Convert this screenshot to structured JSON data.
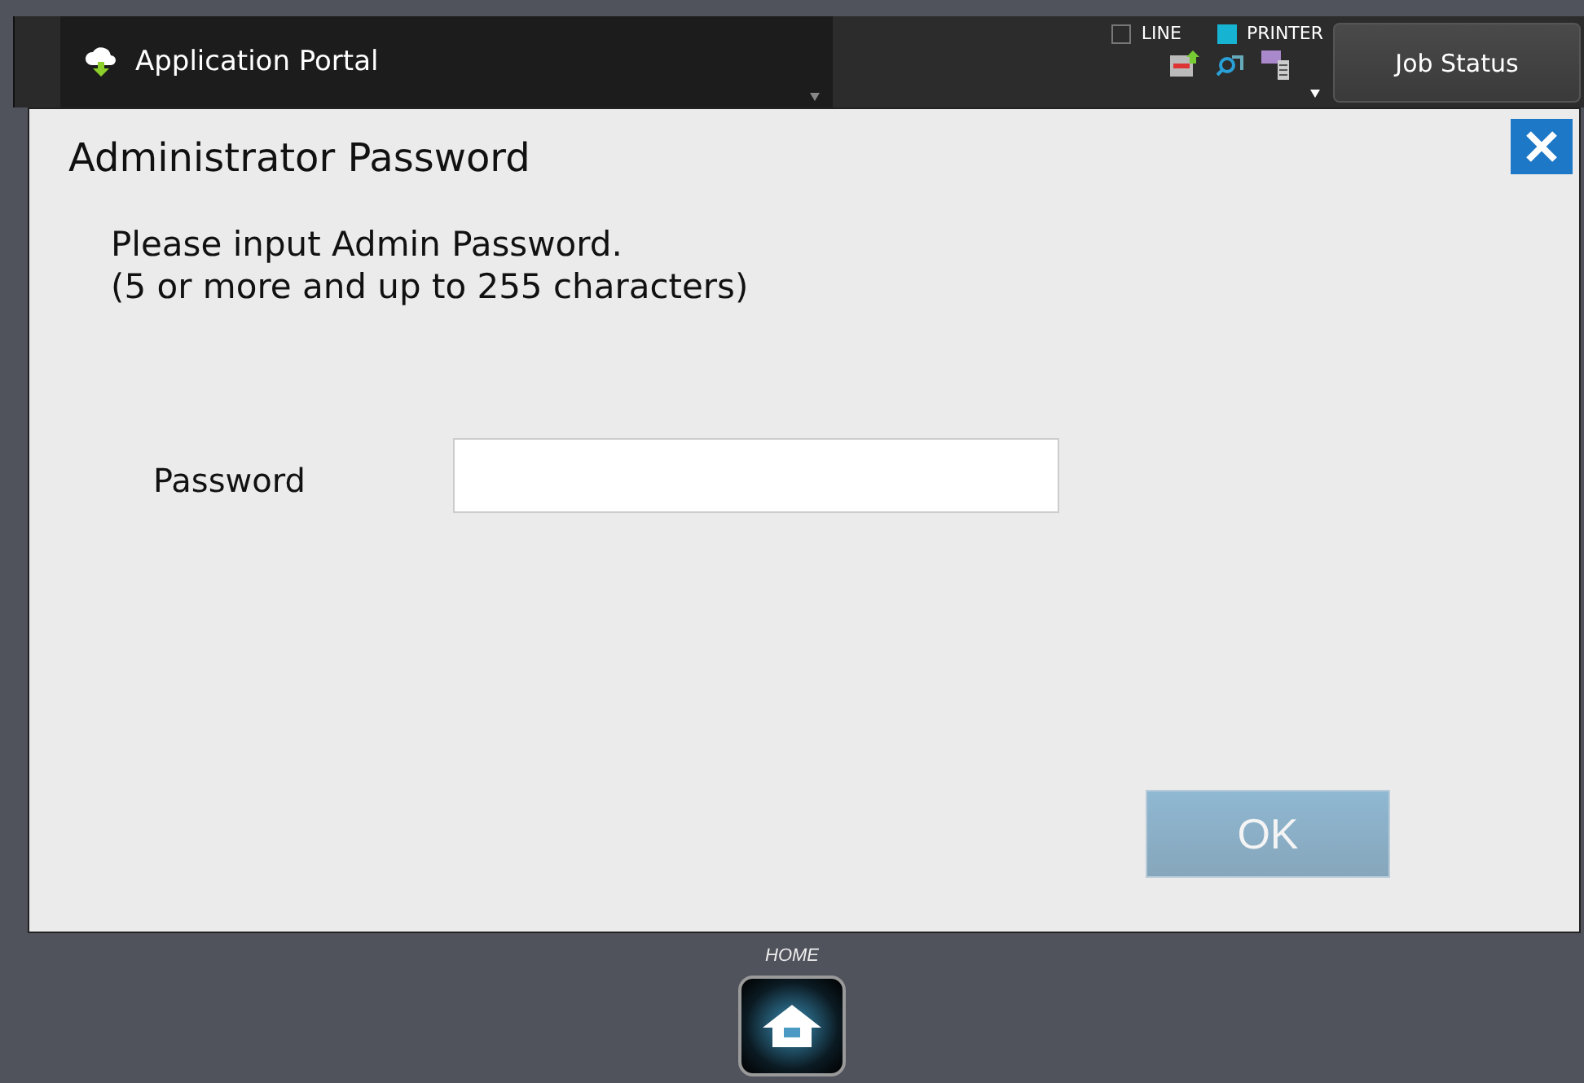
{
  "header": {
    "title": "Application Portal",
    "indicators": [
      {
        "label": "LINE",
        "on": false
      },
      {
        "label": "PRINTER",
        "on": true
      }
    ],
    "job_status": "Job Status"
  },
  "dialog": {
    "title": "Administrator Password",
    "message": "Please input Admin Password.\n(5 or more and up to 255 characters)",
    "field_label": "Password",
    "ok": {
      "label": "OK",
      "disabled": true
    }
  },
  "footer": {
    "home_label": "HOME"
  }
}
